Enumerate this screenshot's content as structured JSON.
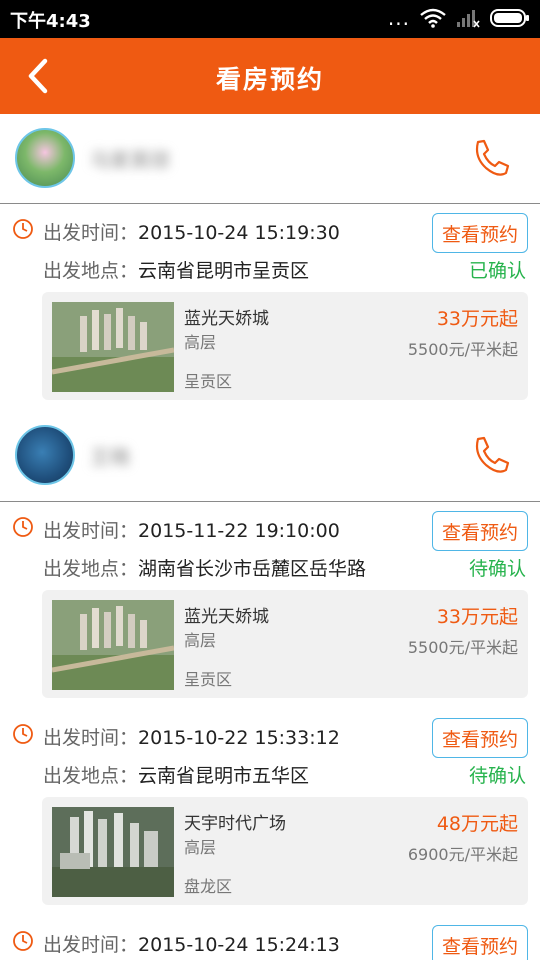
{
  "status_bar": {
    "time": "下午4:43",
    "dots": "..."
  },
  "header": {
    "title": "看房预约"
  },
  "labels": {
    "depart_time": "出发时间：",
    "depart_place": "出发地点：",
    "view_button": "查看预约"
  },
  "users": [
    {
      "name": "马家英琼",
      "orders": [
        {
          "time": "2015-10-24 15:19:30",
          "place": "云南省昆明市呈贡区",
          "status": "已确认",
          "property": {
            "name": "蓝光天娇城",
            "type": "高层",
            "area": "呈贡区",
            "price": "33万元起",
            "unit_price": "5500元/平米起"
          }
        }
      ]
    },
    {
      "name": "王晓",
      "orders": [
        {
          "time": "2015-11-22 19:10:00",
          "place": "湖南省长沙市岳麓区岳华路",
          "status": "待确认",
          "property": {
            "name": "蓝光天娇城",
            "type": "高层",
            "area": "呈贡区",
            "price": "33万元起",
            "unit_price": "5500元/平米起"
          }
        },
        {
          "time": "2015-10-22 15:33:12",
          "place": "云南省昆明市五华区",
          "status": "待确认",
          "property": {
            "name": "天宇时代广场",
            "type": "高层",
            "area": "盘龙区",
            "price": "48万元起",
            "unit_price": "6900元/平米起"
          }
        },
        {
          "time": "2015-10-24 15:24:13"
        }
      ]
    }
  ],
  "colors": {
    "accent": "#ef5a12",
    "status_green": "#27b34d",
    "button_border": "#4fb6e6"
  },
  "icons": {
    "back": "chevron-left-icon",
    "phone": "phone-icon",
    "clock": "clock-icon",
    "wifi": "wifi-icon",
    "signal": "signal-icon",
    "battery": "battery-icon"
  }
}
